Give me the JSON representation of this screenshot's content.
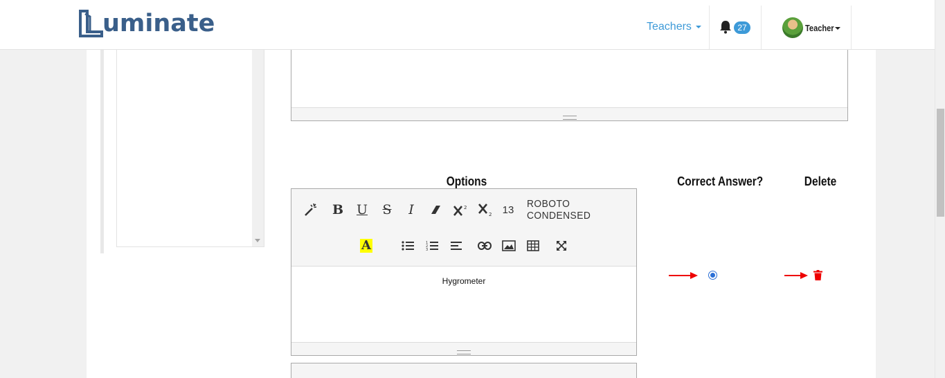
{
  "header": {
    "logo_text": "uminate",
    "nav_teachers": "Teachers",
    "notification_count": "27",
    "user_name": "Teacher"
  },
  "options_section": {
    "col_options": "Options",
    "col_correct": "Correct Answer?",
    "col_delete": "Delete",
    "toolbar": {
      "bold": "B",
      "underline": "U",
      "strike": "S",
      "italic": "I",
      "font_size": "13",
      "font_name": "ROBOTO CONDENSED",
      "color_letter": "A"
    },
    "option_text": "Hygrometer",
    "correct_selected": true
  },
  "colors": {
    "brand": "#3a5f8a",
    "link": "#3d9ad8",
    "annotation_arrow": "#e00000",
    "delete_icon": "#e00000",
    "radio_selected": "#2a6fd6"
  },
  "icons": [
    "bell-icon",
    "magic-wand-icon",
    "eraser-icon",
    "superscript-icon",
    "subscript-icon",
    "text-color-icon",
    "bullet-list-icon",
    "numbered-list-icon",
    "align-icon",
    "link-icon",
    "image-icon",
    "table-icon",
    "fullscreen-icon",
    "trash-icon",
    "red-arrow-icon"
  ]
}
